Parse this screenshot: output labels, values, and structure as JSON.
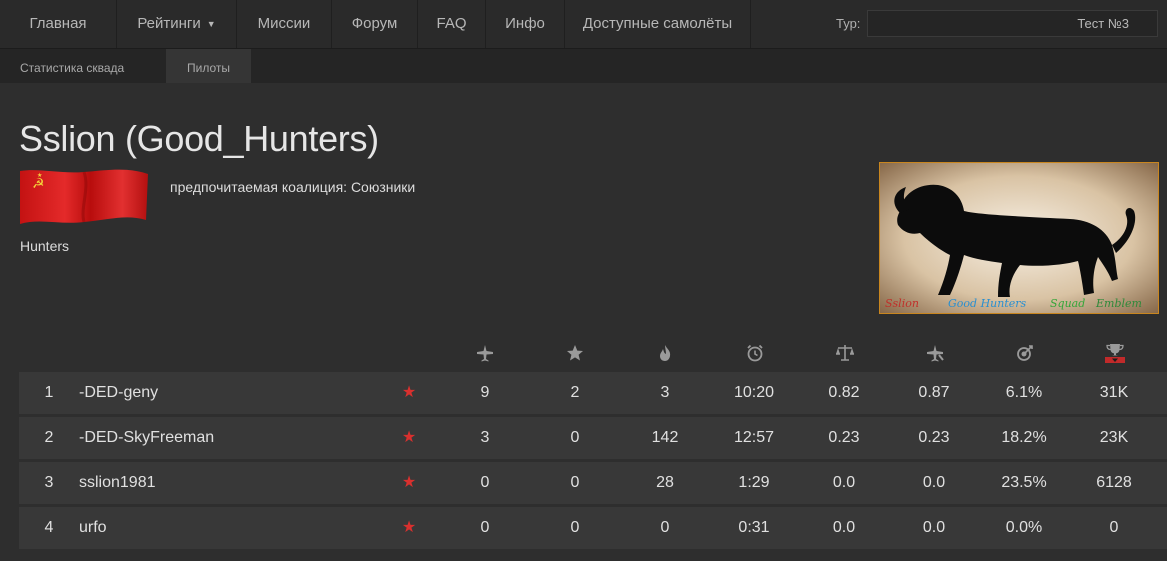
{
  "nav": {
    "items": [
      "Главная",
      "Рейтинги",
      "Миссии",
      "Форум",
      "FAQ",
      "Инфо",
      "Доступные самолёты"
    ],
    "tour_label": "Тур:",
    "tour_value": "Тест №3"
  },
  "subnav": {
    "items": [
      "Статистика сквада",
      "Пилоты"
    ],
    "active": "Пилоты"
  },
  "squad": {
    "title": "Sslion (Good_Hunters)",
    "coalition": "предпочитаемая коалиция: Союзники",
    "description": "Hunters",
    "emblem_text": [
      "Sslion",
      "Good Hunters",
      "Squad",
      "Emblem"
    ]
  },
  "table": {
    "columns": [
      "plane-icon",
      "star-icon",
      "fire-icon",
      "clock-icon",
      "scales-icon",
      "plane-down-icon",
      "target-icon",
      "trophy-icon"
    ],
    "sorted_column": "trophy-icon",
    "rows": [
      {
        "rank": "1",
        "name": "-DED-geny",
        "values": [
          "9",
          "2",
          "3",
          "10:20",
          "0.82",
          "0.87",
          "6.1%",
          "31K"
        ]
      },
      {
        "rank": "2",
        "name": "-DED-SkyFreeman",
        "values": [
          "3",
          "0",
          "142",
          "12:57",
          "0.23",
          "0.23",
          "18.2%",
          "23K"
        ]
      },
      {
        "rank": "3",
        "name": "sslion1981",
        "values": [
          "0",
          "0",
          "28",
          "1:29",
          "0.0",
          "0.0",
          "23.5%",
          "6128"
        ]
      },
      {
        "rank": "4",
        "name": "urfo",
        "values": [
          "0",
          "0",
          "0",
          "0:31",
          "0.0",
          "0.0",
          "0.0%",
          "0"
        ]
      }
    ],
    "star_glyph": "★",
    "star_color": "#d9302e"
  }
}
